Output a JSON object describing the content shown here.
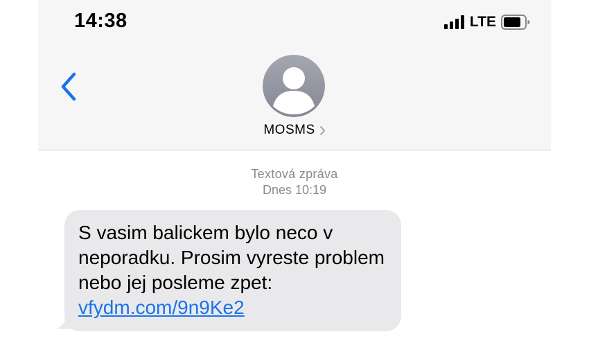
{
  "status_bar": {
    "time": "14:38",
    "network": "LTE"
  },
  "header": {
    "contact_name": "MOSMS"
  },
  "thread": {
    "type_label": "Textová zpráva",
    "timestamp": "Dnes 10:19"
  },
  "message": {
    "text": "S vasim balickem bylo neco v neporadku. Prosim vyreste problem nebo jej posleme zpet: ",
    "link": "vfydm.com/9n9Ke2"
  },
  "colors": {
    "accent": "#1a73e8",
    "bubble": "#e9e9eb",
    "header_bg": "#f6f6f6"
  }
}
